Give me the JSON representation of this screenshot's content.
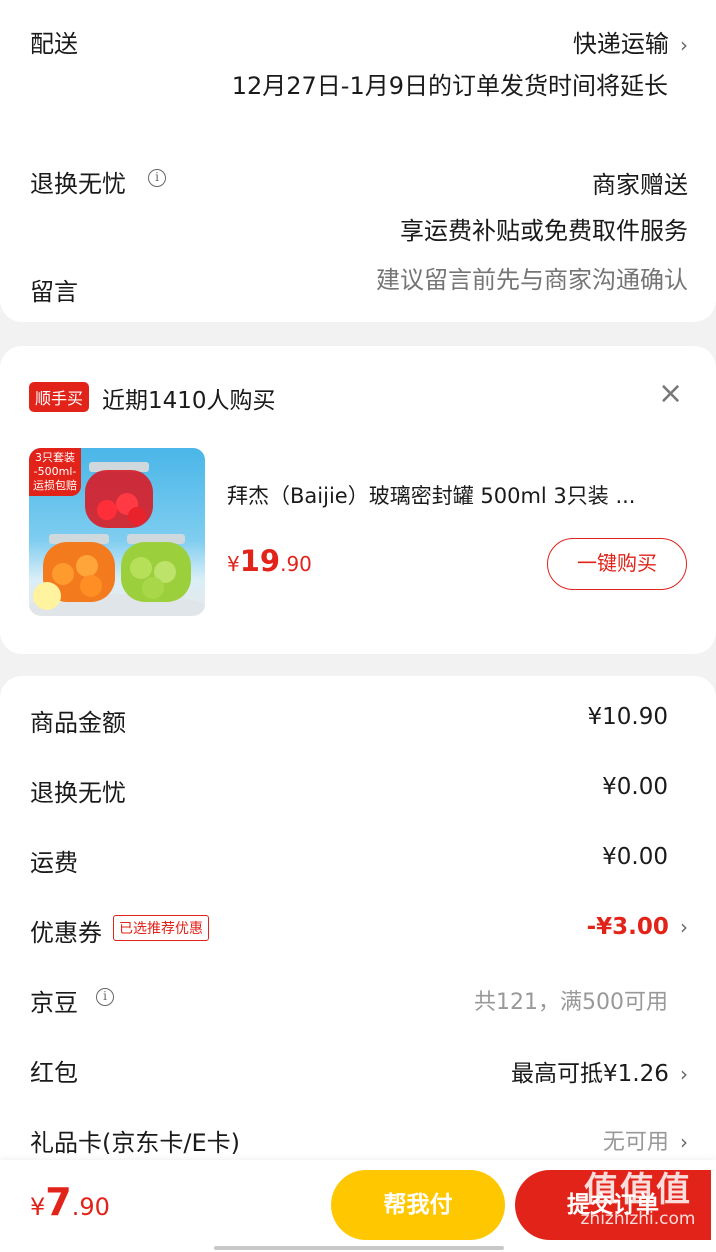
{
  "delivery": {
    "label": "配送",
    "method": "快递运输",
    "notice": "12月27日-1月9日的订单发货时间将延长"
  },
  "return_service": {
    "label": "退换无忧",
    "value_line1": "商家赠送",
    "value_line2": "享运费补贴或免费取件服务"
  },
  "message": {
    "label": "留言",
    "placeholder": "建议留言前先与商家沟通确认"
  },
  "recommend": {
    "tag": "顺手买",
    "title": "近期1410人购买",
    "product": {
      "image_badge_line1": "3只套装",
      "image_badge_line2": "-500ml-",
      "image_badge_line3": "运损包赔",
      "name": "拜杰（Baijie）玻璃密封罐 500ml 3只装 ...",
      "price_symbol": "¥",
      "price_int": "19",
      "price_dec": ".90",
      "buy_label": "一键购买"
    }
  },
  "summary": {
    "rows": [
      {
        "label": "商品金额",
        "value": "¥10.90"
      },
      {
        "label": "退换无忧",
        "value": "¥0.00"
      },
      {
        "label": "运费",
        "value": "¥0.00"
      },
      {
        "label": "优惠券",
        "badge": "已选推荐优惠",
        "value": "-¥3.00"
      },
      {
        "label": "京豆",
        "value": "共121，满500可用"
      },
      {
        "label": "红包",
        "value": "最高可抵¥1.26"
      },
      {
        "label": "礼品卡(京东卡/E卡)",
        "value": "无可用"
      }
    ]
  },
  "footer": {
    "price_symbol": "¥",
    "price_int": "7",
    "price_dec": ".90",
    "help_pay_label": "帮我付",
    "submit_label": "提交订单",
    "watermark_text": "值值值",
    "watermark_url": "zhizhizhi.com"
  },
  "colors": {
    "accent_red": "#e2231a",
    "help_pay_yellow": "#ffc700"
  }
}
